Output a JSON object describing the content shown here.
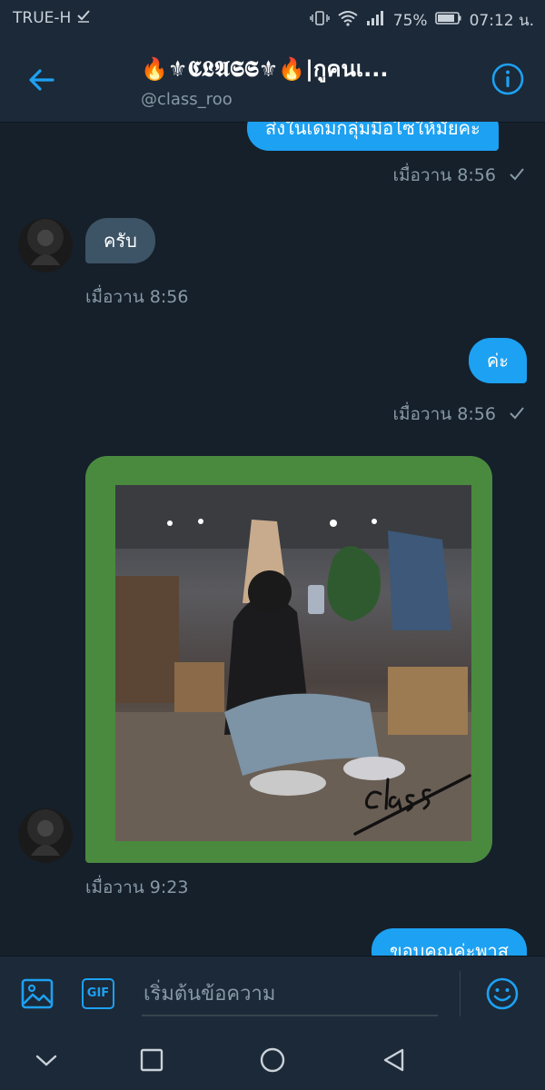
{
  "status_bar": {
    "carrier": "TRUE-H",
    "battery": "75%",
    "time": "07:12 น."
  },
  "header": {
    "title": "🔥⚜𝕮𝕷𝕬𝕾𝕾⚜🔥|กูคนเ...",
    "handle": "@class_roo"
  },
  "messages": [
    {
      "direction": "out",
      "text": "ส่งในเดมกลุ่มมือไซให้มั้ยคะ",
      "time": "เมื่อวาน 8:56",
      "read": true
    },
    {
      "direction": "in",
      "text": "ครับ",
      "time": "เมื่อวาน 8:56"
    },
    {
      "direction": "out",
      "text": "ค่ะ",
      "time": "เมื่อวาน 8:56",
      "read": true
    },
    {
      "direction": "in",
      "type": "image",
      "signature": "class",
      "time": "เมื่อวาน 9:23"
    },
    {
      "direction": "out",
      "text": "ขอบคุณค่ะพาส"
    }
  ],
  "input_bar": {
    "gif_label": "GIF",
    "placeholder": "เริ่มต้นข้อความ"
  },
  "colors": {
    "background": "#15202b",
    "bar": "#1c2938",
    "accent": "#1da1f2",
    "incoming_bubble": "#3d5466",
    "photo_frame": "#4a8a3f",
    "muted_text": "#8899a6"
  },
  "icons": [
    "back-arrow-icon",
    "info-icon",
    "image-icon",
    "gif-icon",
    "emoji-icon",
    "nav-back-icon",
    "nav-home-icon",
    "nav-recents-icon",
    "nav-collapse-icon"
  ]
}
